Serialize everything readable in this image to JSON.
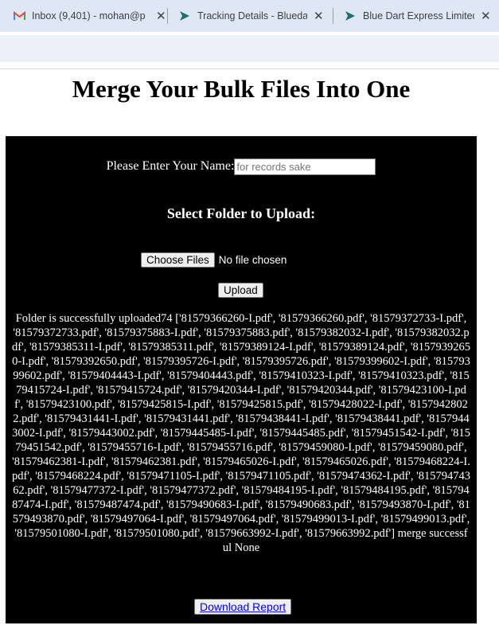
{
  "browser": {
    "tabs": [
      {
        "title": "Inbox (9,401) - mohan@p",
        "icon": "gmail-icon",
        "active": false
      },
      {
        "title": "Tracking Details - Bluedart",
        "icon": "bluedart-icon",
        "active": false
      },
      {
        "title": "Blue Dart Express Limited",
        "icon": "bluedart-icon",
        "active": false
      }
    ],
    "close_glyph": "✕"
  },
  "page": {
    "title": "Merge Your Bulk Files Into One",
    "name_label": "Please Enter Your Name:",
    "name_placeholder": "for records sake",
    "name_value": "",
    "upload_heading": "Select Folder to Upload:",
    "choose_files_label": "Choose Files",
    "no_file_text": "No file chosen",
    "upload_button": "Upload",
    "result_text": "Folder is successfully uploaded74 ['81579366260-I.pdf', '81579366260.pdf', '81579372733-I.pdf', '81579372733.pdf', '81579375883-I.pdf', '81579375883.pdf', '81579382032-I.pdf', '81579382032.pdf', '81579385311-I.pdf', '81579385311.pdf', '81579389124-I.pdf', '81579389124.pdf', '81579392650-I.pdf', '81579392650.pdf', '81579395726-I.pdf', '81579395726.pdf', '81579399602-I.pdf', '81579399602.pdf', '81579404443-I.pdf', '81579404443.pdf', '81579410323-I.pdf', '81579410323.pdf', '81579415724-I.pdf', '81579415724.pdf', '81579420344-I.pdf', '81579420344.pdf', '81579423100-I.pdf', '81579423100.pdf', '81579425815-I.pdf', '81579425815.pdf', '81579428022-I.pdf', '81579428022.pdf', '81579431441-I.pdf', '81579431441.pdf', '81579438441-I.pdf', '81579438441.pdf', '81579443002-I.pdf', '81579443002.pdf', '81579445485-I.pdf', '81579445485.pdf', '81579451542-I.pdf', '81579451542.pdf', '81579455716-I.pdf', '81579455716.pdf', '81579459080-I.pdf', '81579459080.pdf', '81579462381-I.pdf', '81579462381.pdf', '81579465026-I.pdf', '81579465026.pdf', '81579468224-I.pdf', '81579468224.pdf', '81579471105-I.pdf', '81579471105.pdf', '81579474362-I.pdf', '81579474362.pdf', '81579477372-I.pdf', '81579477372.pdf', '81579484195-I.pdf', '81579484195.pdf', '81579487474-I.pdf', '81579487474.pdf', '81579490683-I.pdf', '81579490683.pdf', '81579493870-I.pdf', '81579493870.pdf', '81579497064-I.pdf', '81579497064.pdf', '81579499013-I.pdf', '81579499013.pdf', '81579501080-I.pdf', '81579501080.pdf', '81579663992-I.pdf', '81579663992.pdf'] merge successful None",
    "download_link": "Download Report"
  },
  "colors": {
    "panel_bg": "#000000",
    "tab_strip": "#dfe7f5",
    "link": "#0000ee",
    "gmail_red": "#ea4335",
    "bluedart_green": "#2e7d32"
  }
}
